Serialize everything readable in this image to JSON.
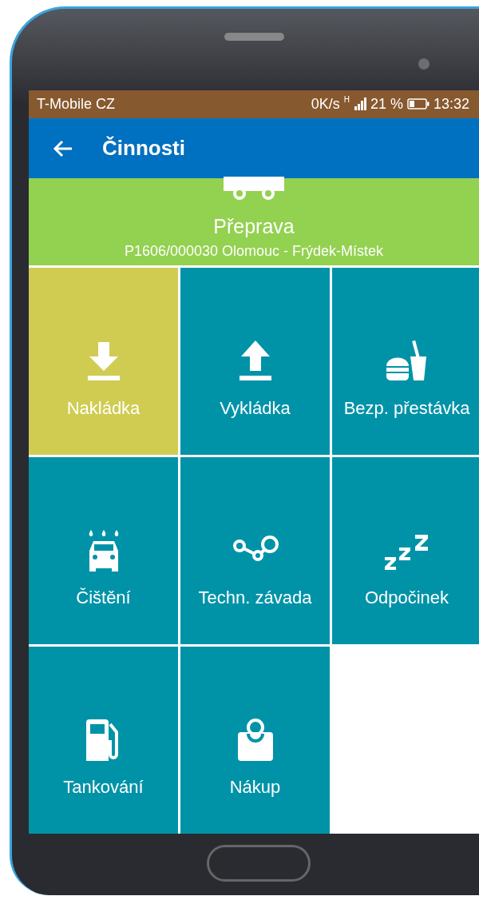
{
  "status_bar": {
    "carrier": "T-Mobile CZ",
    "speed": "0K/s",
    "network": "H",
    "battery": "21 %",
    "time": "13:32"
  },
  "app_bar": {
    "title": "Činnosti"
  },
  "transport": {
    "title": "Přeprava",
    "subtitle": "P1606/000030 Olomouc - Frýdek-Místek"
  },
  "tiles": [
    {
      "label": "Nakládka",
      "kind": "load",
      "selected": true
    },
    {
      "label": "Vykládka",
      "kind": "unload",
      "selected": false
    },
    {
      "label": "Bezp. přestávka",
      "kind": "food",
      "selected": false
    },
    {
      "label": "Čištění",
      "kind": "wash",
      "selected": false
    },
    {
      "label": "Techn. závada",
      "kind": "fault",
      "selected": false
    },
    {
      "label": "Odpočinek",
      "kind": "rest",
      "selected": false
    },
    {
      "label": "Tankování",
      "kind": "fuel",
      "selected": false
    },
    {
      "label": "Nákup",
      "kind": "shop",
      "selected": false
    }
  ]
}
